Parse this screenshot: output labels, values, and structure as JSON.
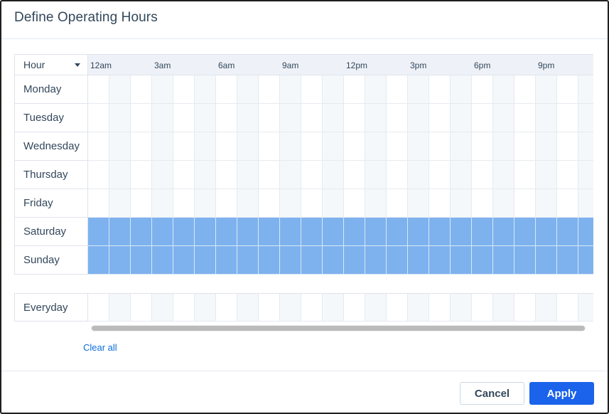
{
  "dialog": {
    "title": "Define Operating Hours"
  },
  "grid": {
    "header_label": "Hour",
    "hour_labels": [
      "12am",
      "3am",
      "6am",
      "9am",
      "12pm",
      "3pm",
      "6pm",
      "9pm"
    ],
    "rows": [
      {
        "label": "Monday",
        "selected": false
      },
      {
        "label": "Tuesday",
        "selected": false
      },
      {
        "label": "Wednesday",
        "selected": false
      },
      {
        "label": "Thursday",
        "selected": false
      },
      {
        "label": "Friday",
        "selected": false
      },
      {
        "label": "Saturday",
        "selected": true
      },
      {
        "label": "Sunday",
        "selected": true
      }
    ],
    "everyday": {
      "label": "Everyday",
      "selected": false
    },
    "selected_color": "#7eb2ee"
  },
  "actions": {
    "clear_all": "Clear all",
    "cancel": "Cancel",
    "apply": "Apply"
  },
  "colors": {
    "accent": "#1a63ea",
    "link": "#0b6ed8"
  }
}
